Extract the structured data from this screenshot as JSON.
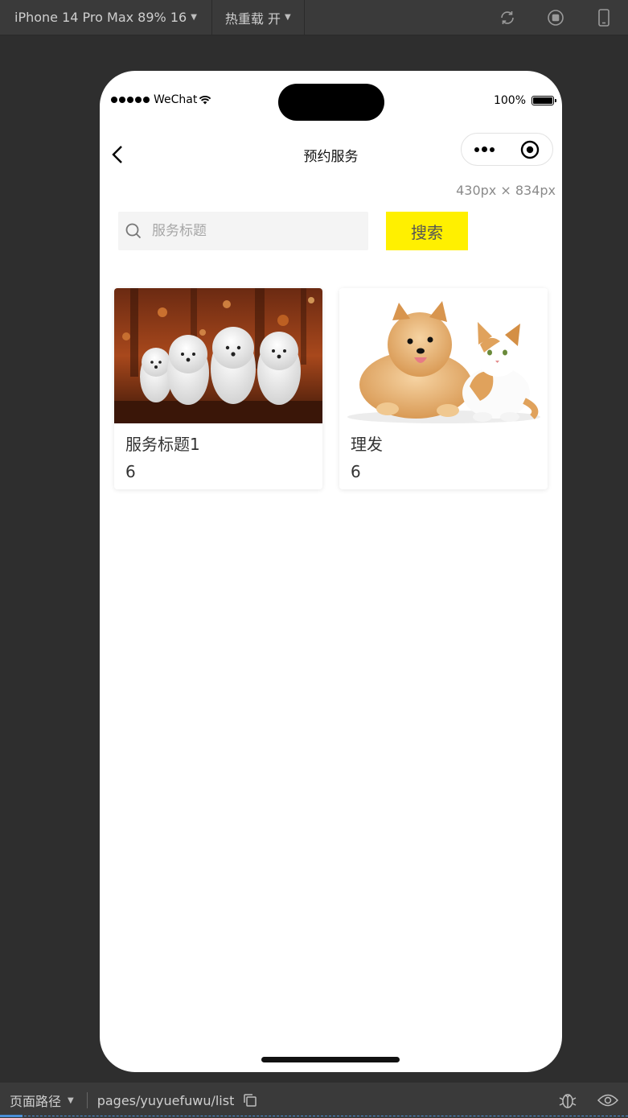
{
  "toolbar": {
    "device_label": "iPhone 14 Pro Max 89% 16",
    "hot_reload_label": "热重载 开",
    "icons": [
      "refresh-icon",
      "stop-icon",
      "phone-icon"
    ]
  },
  "status_bar": {
    "carrier": "WeChat",
    "battery": "100%"
  },
  "navbar": {
    "title": "预约服务"
  },
  "dims_label": "430px × 834px",
  "search": {
    "placeholder": "服务标题",
    "value": "",
    "button_label": "搜索",
    "button_color": "#fff000"
  },
  "cards": [
    {
      "title": "服务标题1",
      "count": "6",
      "image": "white-poodle-dogs-photo"
    },
    {
      "title": "理发",
      "count": "6",
      "image": "pomeranian-and-cat-photo"
    }
  ],
  "bottom_bar": {
    "label": "页面路径",
    "path": "pages/yuyuefuwu/list",
    "icons": [
      "copy-icon",
      "bug-icon",
      "eye-icon"
    ]
  }
}
